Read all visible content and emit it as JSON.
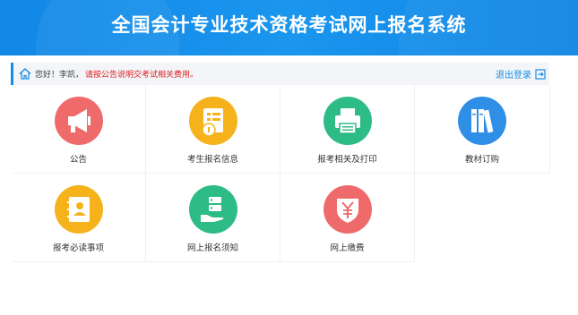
{
  "header": {
    "title": "全国会计专业技术资格考试网上报名系统"
  },
  "welcome": {
    "greeting": "您好！李凯，",
    "notice": "请按公告说明交考试相关费用。",
    "logout_label": "退出登录"
  },
  "tiles": [
    {
      "label": "公告",
      "icon": "megaphone-icon",
      "color": "#ef6b6b"
    },
    {
      "label": "考生报名信息",
      "icon": "document-info-icon",
      "color": "#f5b21b"
    },
    {
      "label": "报考相关及打印",
      "icon": "printer-icon",
      "color": "#2dbb86"
    },
    {
      "label": "教材订购",
      "icon": "books-icon",
      "color": "#2f8ee5"
    },
    {
      "label": "报考必读事项",
      "icon": "address-book-icon",
      "color": "#f5b21b"
    },
    {
      "label": "网上报名须知",
      "icon": "server-hand-icon",
      "color": "#2dbb86"
    },
    {
      "label": "网上缴费",
      "icon": "yuan-shield-icon",
      "color": "#ef6b6b"
    }
  ]
}
